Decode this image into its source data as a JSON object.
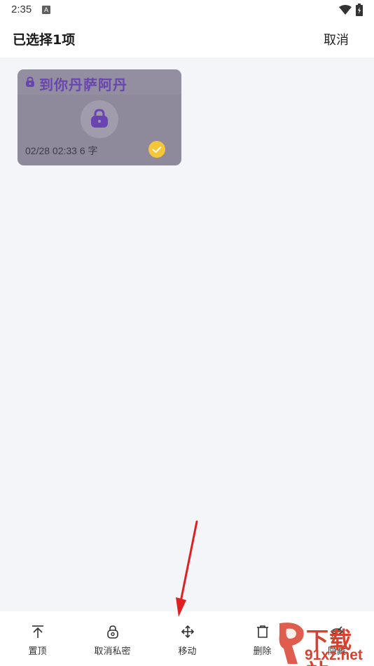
{
  "status_bar": {
    "time": "2:35",
    "indicator": "A"
  },
  "header": {
    "title": "已选择1项",
    "cancel_label": "取消"
  },
  "note": {
    "title": "到你丹萨阿丹",
    "meta": "02/28 02:33  6 字",
    "selected": true,
    "colors": {
      "card": "#8f8a9b",
      "title": "#6a45b2",
      "check": "#f5c53a"
    }
  },
  "bottom_bar": {
    "items": [
      {
        "label": "置顶",
        "icon": "pin-top-icon"
      },
      {
        "label": "取消私密",
        "icon": "unlock-icon"
      },
      {
        "label": "移动",
        "icon": "move-icon"
      },
      {
        "label": "删除",
        "icon": "delete-icon"
      },
      {
        "label": "隐藏",
        "icon": "hide-icon"
      }
    ]
  },
  "watermark": {
    "top_text": "下载站",
    "bottom_text": "91xz.net"
  }
}
